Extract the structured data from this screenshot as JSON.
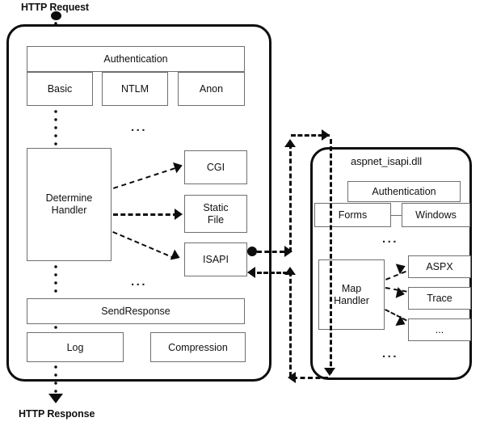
{
  "diagram": {
    "title_top": "HTTP Request",
    "title_bottom": "HTTP Response",
    "ellipsis": "...",
    "iis_pipeline": {
      "authentication": {
        "label": "Authentication",
        "providers": [
          "Basic",
          "NTLM",
          "Anon"
        ]
      },
      "determine_handler": {
        "label": "Determine\nHandler",
        "line1": "Determine",
        "line2": "Handler"
      },
      "handlers": [
        {
          "label": "CGI"
        },
        {
          "label": "Static\nFile",
          "line1": "Static",
          "line2": "File"
        },
        {
          "label": "ISAPI"
        }
      ],
      "send_response": {
        "label": "SendResponse",
        "modules": [
          "Log",
          "Compression"
        ]
      }
    },
    "aspnet_isapi": {
      "title": "aspnet_isapi.dll",
      "authentication": {
        "label": "Authentication",
        "providers": [
          "Forms",
          "Windows"
        ]
      },
      "map_handler": {
        "label": "Map\nHandler",
        "line1": "Map",
        "line2": "Handler"
      },
      "handlers": [
        {
          "label": "ASPX"
        },
        {
          "label": "Trace"
        },
        {
          "label": "..."
        }
      ]
    },
    "colors": {
      "outline": "#0d0d0d",
      "box_border": "#6f6f6f",
      "background": "#ffffff",
      "text": "#111111"
    }
  }
}
